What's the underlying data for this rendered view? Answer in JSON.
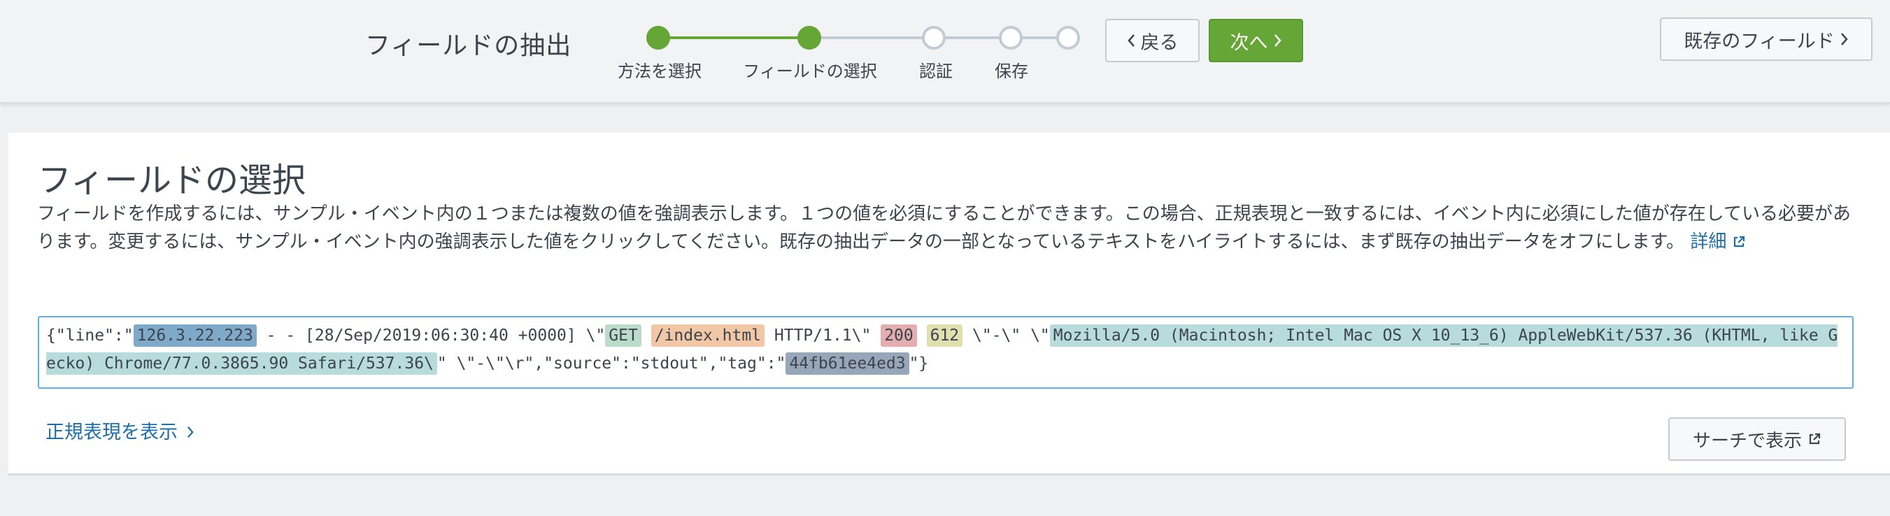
{
  "header": {
    "title": "フィールドの抽出",
    "steps": [
      {
        "label": "方法を選択",
        "state": "done"
      },
      {
        "label": "フィールドの選択",
        "state": "done"
      },
      {
        "label": "認証",
        "state": "pending"
      },
      {
        "label": "保存",
        "state": "pending"
      },
      {
        "label": "",
        "state": "pending"
      }
    ],
    "back_label": "戻る",
    "next_label": "次へ",
    "existing_fields_label": "既存のフィールド"
  },
  "main": {
    "title": "フィールドの選択",
    "description": "フィールドを作成するには、サンプル・イベント内の１つまたは複数の値を強調表示します。１つの値を必須にすることができます。この場合、正規表現と一致するには、イベント内に必須にした値が存在している必要があります。変更するには、サンプル・イベント内の強調表示した値をクリックしてください。既存の抽出データの一部となっているテキストをハイライトするには、まず既存の抽出データをオフにします。",
    "details_link": "詳細",
    "sample": {
      "t0": "{\"line\":\"",
      "ip": "126.3.22.223",
      "t1": " - - [28/Sep/2019:06:30:40 +0000] \\\"",
      "method": "GET",
      "t2": " ",
      "path": "/index.html",
      "t3": " HTTP/1.1\\\" ",
      "status": "200",
      "t4": " ",
      "size": "612",
      "t5": " \\\"-\\\" \\\"",
      "agent": "Mozilla/5.0 (Macintosh; Intel Mac OS X 10_13_6) AppleWebKit/537.36 (KHTML, like Gecko) Chrome/77.0.3865.90 Safari/537.36\\",
      "t6": "\" \\\"-\\\"\\r\",\"source\":\"stdout\",\"tag\":\"",
      "tag": "44fb61ee4ed3",
      "t7": "\"}"
    },
    "regex_link": "正規表現を表示",
    "search_button": "サーチで表示"
  },
  "colors": {
    "accent_green": "#65a637",
    "link_blue": "#1e6fa8",
    "highlight_ip": "#7fa9c8",
    "highlight_method": "#bcdccb",
    "highlight_path": "#f2c7a6",
    "highlight_status": "#e4aeae",
    "highlight_size": "#e2dfae",
    "highlight_agent": "#b8dcdc",
    "highlight_tag": "#98a6b9"
  },
  "icons": {
    "external": "external-link-icon",
    "chevron_left": "chevron-left-icon",
    "chevron_right": "chevron-right-icon"
  }
}
